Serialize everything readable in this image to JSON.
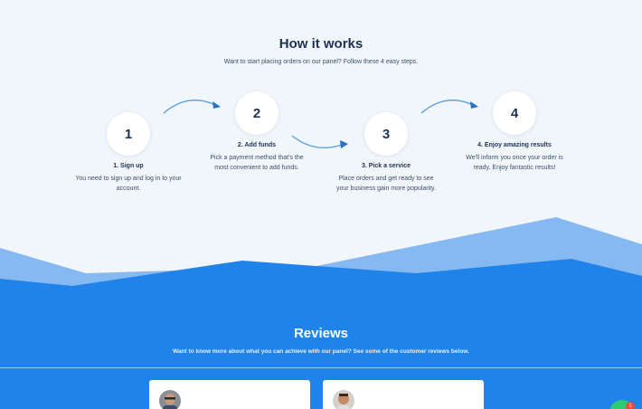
{
  "how_it_works": {
    "title": "How it works",
    "subtitle": "Want to start placing orders on our panel? Follow these 4 easy steps.",
    "steps": [
      {
        "number": "1",
        "title": "1. Sign up",
        "description": "You need to sign up and log in to your account."
      },
      {
        "number": "2",
        "title": "2. Add funds",
        "description": "Pick a payment method that's the most convenient to add funds."
      },
      {
        "number": "3",
        "title": "3. Pick a service",
        "description": "Place orders and get ready to see your business gain more popularity."
      },
      {
        "number": "4",
        "title": "4. Enjoy amazing results",
        "description": "We'll inform you once your order is ready. Enjoy fantastic results!"
      }
    ]
  },
  "reviews": {
    "title": "Reviews",
    "subtitle": "Want to know more about what you can achieve with our panel? See some of the customer reviews below."
  },
  "chat": {
    "badge": "1"
  },
  "colors": {
    "primary": "#1f83ea",
    "light_wave": "#86b9f2",
    "background": "#f1f6fb",
    "heading": "#1c3154",
    "arrow": "#5a9fd8"
  }
}
